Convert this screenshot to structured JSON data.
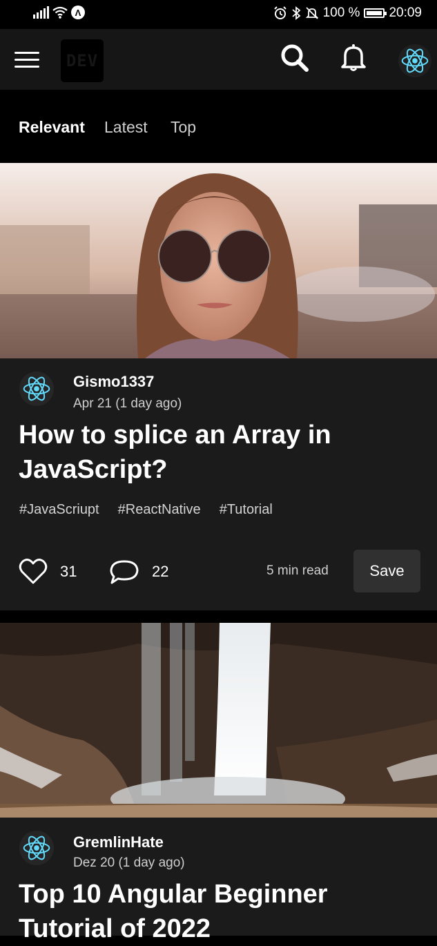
{
  "status_bar": {
    "battery": "100 %",
    "battery_level": 1.0,
    "time": "20:09"
  },
  "header": {
    "logo": "DEV",
    "icons": [
      "menu-icon",
      "search-icon",
      "bell-icon",
      "react-avatar"
    ]
  },
  "tabs": [
    {
      "label": "Relevant",
      "active": true
    },
    {
      "label": "Latest",
      "active": false
    },
    {
      "label": "Top",
      "active": false
    }
  ],
  "posts": [
    {
      "author": "Gismo1337",
      "date": "Apr 21 (1 day ago)",
      "title": "How to splice an Array in JavaScript?",
      "tags": [
        "#JavaScriupt",
        "#ReactNative",
        "#Tutorial"
      ],
      "likes": "31",
      "comments": "22",
      "read_time": "5 min read",
      "save_label": "Save"
    },
    {
      "author": "GremlinHate",
      "date": "Dez 20 (1 day ago)",
      "title": "Top 10 Angular Beginner Tutorial of 2022"
    }
  ],
  "colors": {
    "background": "#000000",
    "card": "#1b1b1b",
    "header": "#161616",
    "react_logo": "#61dafb",
    "save_button": "#303030"
  }
}
